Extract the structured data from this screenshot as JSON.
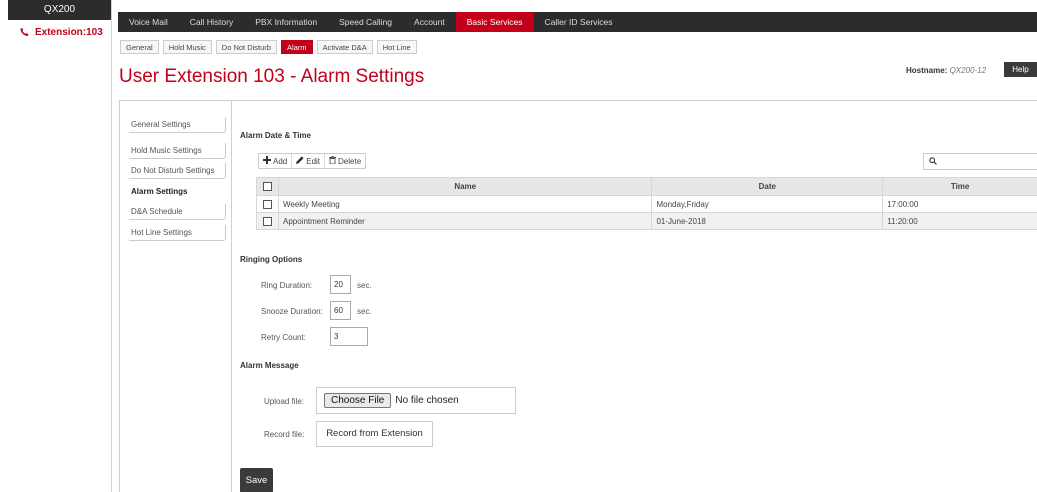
{
  "brand": "QX200",
  "extension_label": "Extension:103",
  "topnav": [
    {
      "label": "Voice Mail",
      "active": false
    },
    {
      "label": "Call History",
      "active": false
    },
    {
      "label": "PBX Information",
      "active": false
    },
    {
      "label": "Speed Calling",
      "active": false
    },
    {
      "label": "Account",
      "active": false
    },
    {
      "label": "Basic Services",
      "active": true
    },
    {
      "label": "Caller ID Services",
      "active": false
    }
  ],
  "subnav": [
    {
      "label": "General",
      "active": false
    },
    {
      "label": "Hold Music",
      "active": false
    },
    {
      "label": "Do Not Disturb",
      "active": false
    },
    {
      "label": "Alarm",
      "active": true
    },
    {
      "label": "Activate D&A",
      "active": false
    },
    {
      "label": "Hot Line",
      "active": false
    }
  ],
  "page_title": "User Extension 103 - Alarm Settings",
  "hostname_label": "Hostname:",
  "hostname_value": "QX200-12",
  "help_label": "Help",
  "sidebar": [
    {
      "label": "General Settings",
      "active": false
    },
    {
      "label": "Hold Music Settings",
      "active": false
    },
    {
      "label": "Do Not Disturb Settings",
      "active": false
    },
    {
      "label": "Alarm Settings",
      "active": true
    },
    {
      "label": "D&A Schedule",
      "active": false
    },
    {
      "label": "Hot Line Settings",
      "active": false
    }
  ],
  "alarm_section_title": "Alarm Date & Time",
  "toolbar": {
    "add": "Add",
    "edit": "Edit",
    "delete": "Delete"
  },
  "search": {
    "placeholder": ""
  },
  "table": {
    "headers": {
      "name": "Name",
      "date": "Date",
      "time": "Time"
    },
    "rows": [
      {
        "name": "Weekly Meeting",
        "date": "Monday,Friday",
        "time": "17:00:00"
      },
      {
        "name": "Appointment Reminder",
        "date": "01-June-2018",
        "time": "11:20:00"
      }
    ]
  },
  "ringing": {
    "title": "Ringing Options",
    "ring_duration_label": "Ring Duration:",
    "ring_duration_value": "20",
    "snooze_duration_label": "Snooze Duration:",
    "snooze_duration_value": "60",
    "retry_count_label": "Retry Count:",
    "retry_count_value": "3",
    "unit": "sec."
  },
  "message": {
    "title": "Alarm Message",
    "upload_label": "Upload file:",
    "choose_file": "Choose File",
    "no_file": "No file chosen",
    "record_label": "Record file:",
    "record_button": "Record from Extension"
  },
  "save_label": "Save",
  "colors": {
    "accent": "#c3001a",
    "dark_bar": "#2c2c2c"
  },
  "icons": {
    "phone": "phone-icon",
    "add": "plus-icon",
    "edit": "pencil-icon",
    "delete": "trash-icon",
    "search": "search-icon"
  }
}
